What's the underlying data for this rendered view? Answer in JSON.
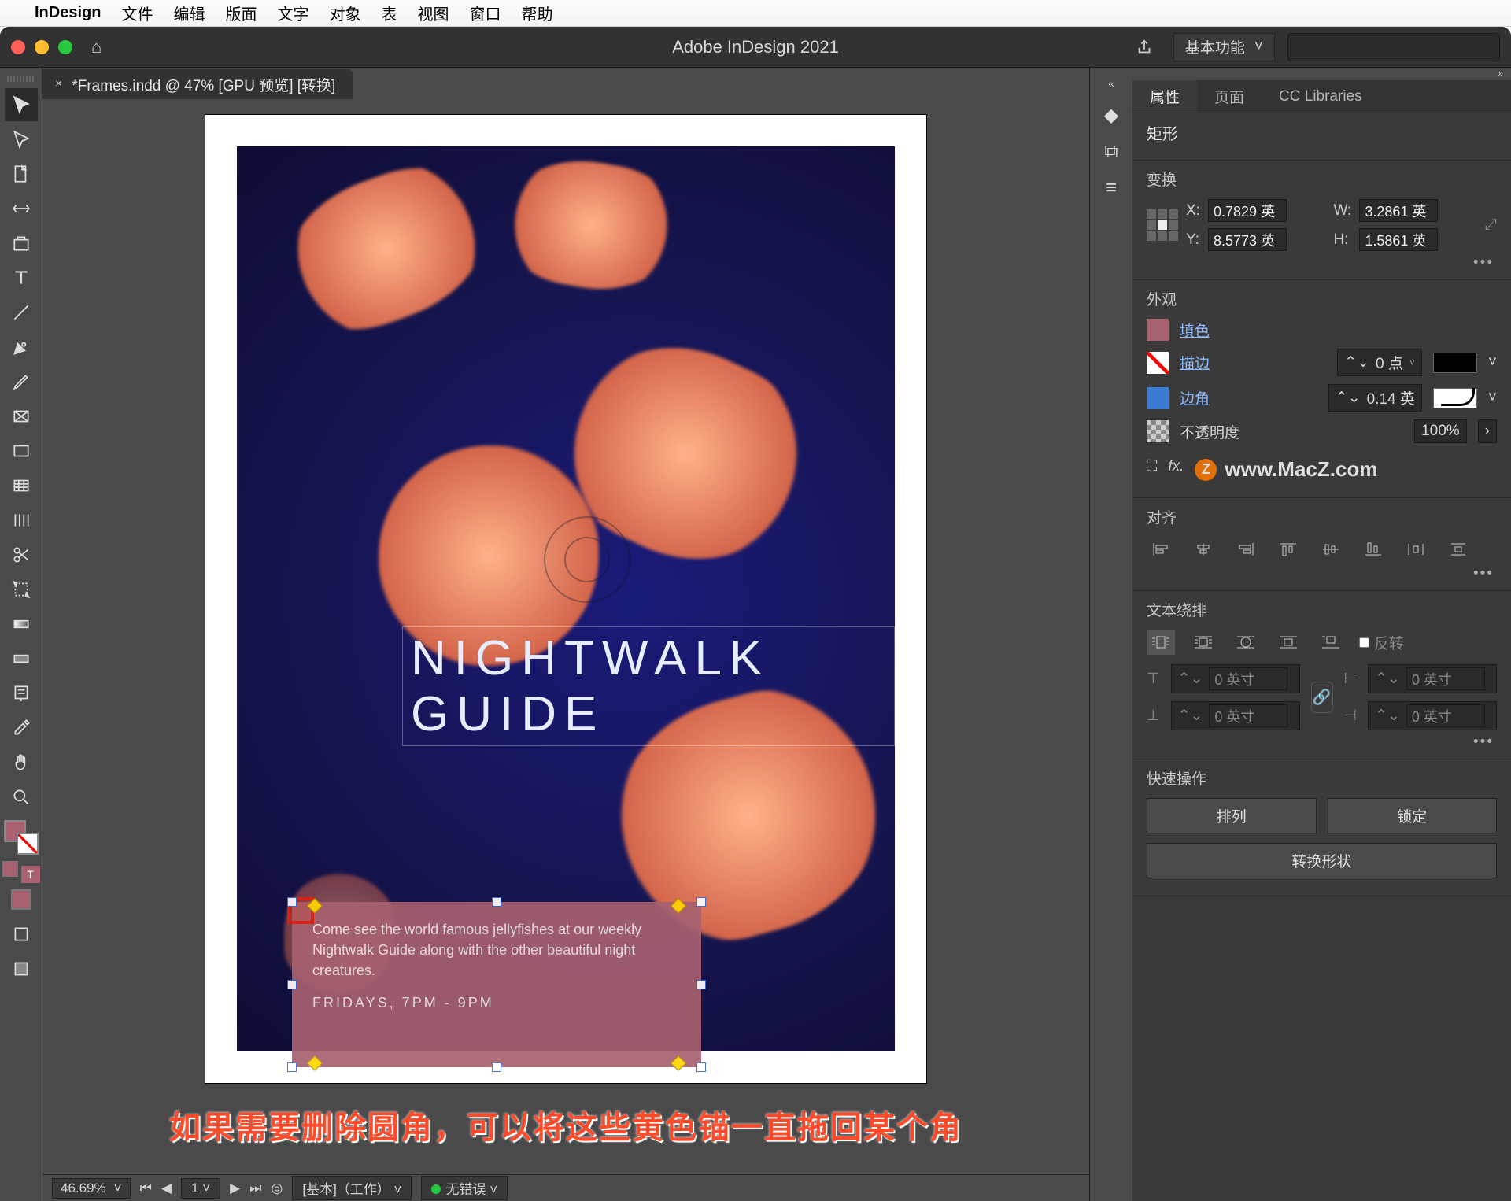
{
  "mac_menu": {
    "app": "InDesign",
    "items": [
      "文件",
      "编辑",
      "版面",
      "文字",
      "对象",
      "表",
      "视图",
      "窗口",
      "帮助"
    ]
  },
  "window": {
    "title": "Adobe InDesign 2021",
    "workspace": "基本功能"
  },
  "doc_tab": {
    "label": "*Frames.indd @ 47% [GPU 预览] [转换]"
  },
  "artwork": {
    "headline": "NIGHTWALK GUIDE",
    "body": "Come see the world famous jellyfishes at our weekly Nightwalk Guide along with the other beautiful night creatures.",
    "times": "FRIDAYS, 7PM - 9PM"
  },
  "annotation": "如果需要删除圆角，可以将这些黄色锚一直拖回某个角",
  "statusbar": {
    "zoom": "46.69%",
    "page": "1",
    "workspace": "[基本]（工作）",
    "errors": "无错误"
  },
  "panel": {
    "tabs": {
      "properties": "属性",
      "pages": "页面",
      "cc": "CC Libraries"
    },
    "shape_kind": "矩形",
    "sections": {
      "transform": "变换",
      "appearance": "外观",
      "align": "对齐",
      "textwrap": "文本绕排",
      "quickops": "快速操作"
    },
    "transform": {
      "x_label": "X:",
      "x": "0.7829 英",
      "y_label": "Y:",
      "y": "8.5773 英",
      "w_label": "W:",
      "w": "3.2861 英",
      "h_label": "H:",
      "h": "1.5861 英"
    },
    "appearance": {
      "fill_label": "填色",
      "stroke_label": "描边",
      "stroke_val": "0 点",
      "corner_label": "边角",
      "corner_val": "0.14 英",
      "opacity_label": "不透明度",
      "opacity_val": "100%"
    },
    "watermark": "www.MacZ.com",
    "textwrap": {
      "invert_label": "反转",
      "offset_val": "0 英寸"
    },
    "quickops": {
      "arrange": "排列",
      "lock": "锁定",
      "convert": "转换形状"
    }
  }
}
